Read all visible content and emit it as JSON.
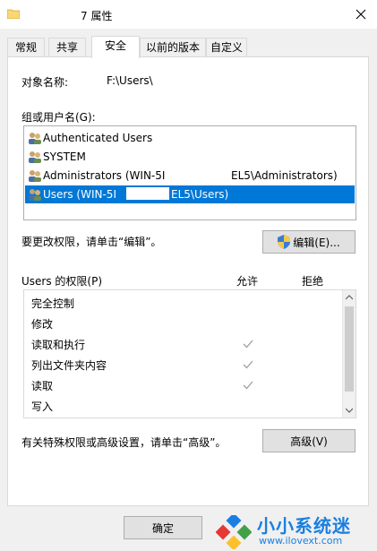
{
  "window": {
    "title_suffix": "7 属性",
    "close_icon": "close-icon",
    "folder_icon": "folder-icon"
  },
  "tabs": [
    {
      "label": "常规",
      "active": false
    },
    {
      "label": "共享",
      "active": false
    },
    {
      "label": "安全",
      "active": true
    },
    {
      "label": "以前的版本",
      "active": false
    },
    {
      "label": "自定义",
      "active": false
    }
  ],
  "security": {
    "object_name_label": "对象名称:",
    "object_name_value": "F:\\Users\\",
    "group_label": "组或用户名(G):",
    "users": [
      {
        "text": "Authenticated Users",
        "icon": "users-group-icon",
        "selected": false
      },
      {
        "text": "SYSTEM",
        "icon": "users-group-icon",
        "selected": false
      },
      {
        "text": "Administrators (WIN-5I",
        "text_right": "EL5\\Administrators)",
        "icon": "users-group-icon",
        "selected": false
      },
      {
        "text": "Users (WIN-5I",
        "text_right": "EL5\\Users)",
        "icon": "users-group-icon",
        "selected": true
      }
    ],
    "change_perm_text": "要更改权限，请单击“编辑”。",
    "edit_button": "编辑(E)...",
    "perm_header_label": "Users 的权限(P)",
    "perm_allow_col": "允许",
    "perm_deny_col": "拒绝",
    "permissions": [
      {
        "name": "完全控制",
        "allow": false
      },
      {
        "name": "修改",
        "allow": false
      },
      {
        "name": "读取和执行",
        "allow": true
      },
      {
        "name": "列出文件夹内容",
        "allow": true
      },
      {
        "name": "读取",
        "allow": true
      },
      {
        "name": "写入",
        "allow": false
      }
    ],
    "advanced_text": "有关特殊权限或高级设置，请单击“高级”。",
    "advanced_button": "高级(V)"
  },
  "footer": {
    "ok_button": "确定"
  },
  "watermark": {
    "text": "小小系统迷",
    "url": "www.ilovext.com"
  },
  "colors": {
    "selection": "#0078d7",
    "watermark": "#1a7fe0"
  }
}
